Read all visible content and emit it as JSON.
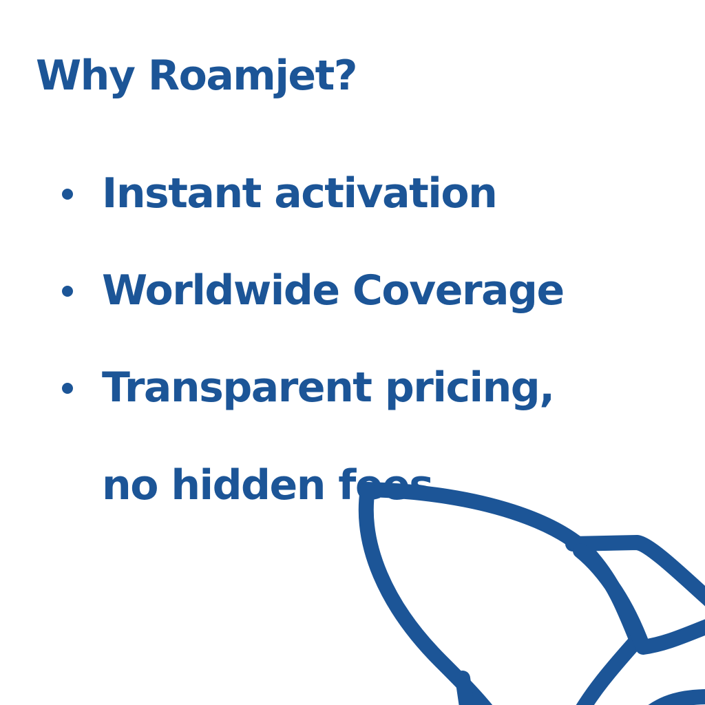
{
  "brand": {
    "accent_color": "#1c5597",
    "background_color": "#ffffff"
  },
  "heading": "Why Roamjet?",
  "features": [
    {
      "label": "Instant activation"
    },
    {
      "label": "Worldwide Coverage"
    },
    {
      "label": "Transparent pricing, no hidden fees"
    }
  ],
  "decoration": {
    "icon": "rocket-outline-icon"
  }
}
